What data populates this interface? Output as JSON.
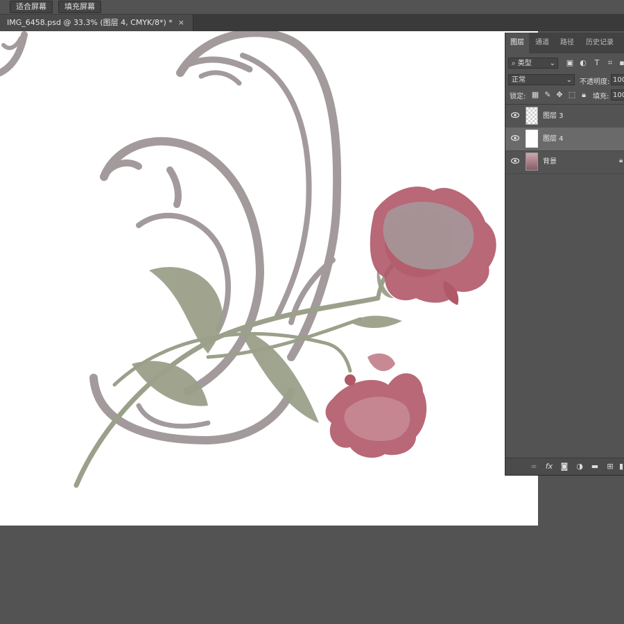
{
  "options_bar": {
    "fit_screen": "适合屏幕",
    "fill_screen": "填充屏幕"
  },
  "document_tab": {
    "title": "IMG_6458.psd @ 33.3% (图层 4, CMYK/8*) *",
    "close": "×"
  },
  "layers_panel": {
    "tabs": [
      "图层",
      "通道",
      "路径",
      "历史记录"
    ],
    "filter_kind": "类型",
    "blend_mode": "正常",
    "opacity_label": "不透明度:",
    "opacity_value": "100",
    "lock_label": "锁定:",
    "fill_label": "填充:",
    "fill_value": "100",
    "layers": [
      {
        "name": "图层 3",
        "visible": true,
        "selected": false
      },
      {
        "name": "图层 4",
        "visible": true,
        "selected": true
      },
      {
        "name": "背景",
        "visible": true,
        "selected": false,
        "locked": true
      }
    ]
  },
  "colors": {
    "workspace": "#535353",
    "panel": "#535353",
    "selected_layer": "#6a6a6a",
    "embroidery_gray": "#a39a9c",
    "embroidery_green": "#9ba08a",
    "embroidery_red": "#b05868"
  }
}
